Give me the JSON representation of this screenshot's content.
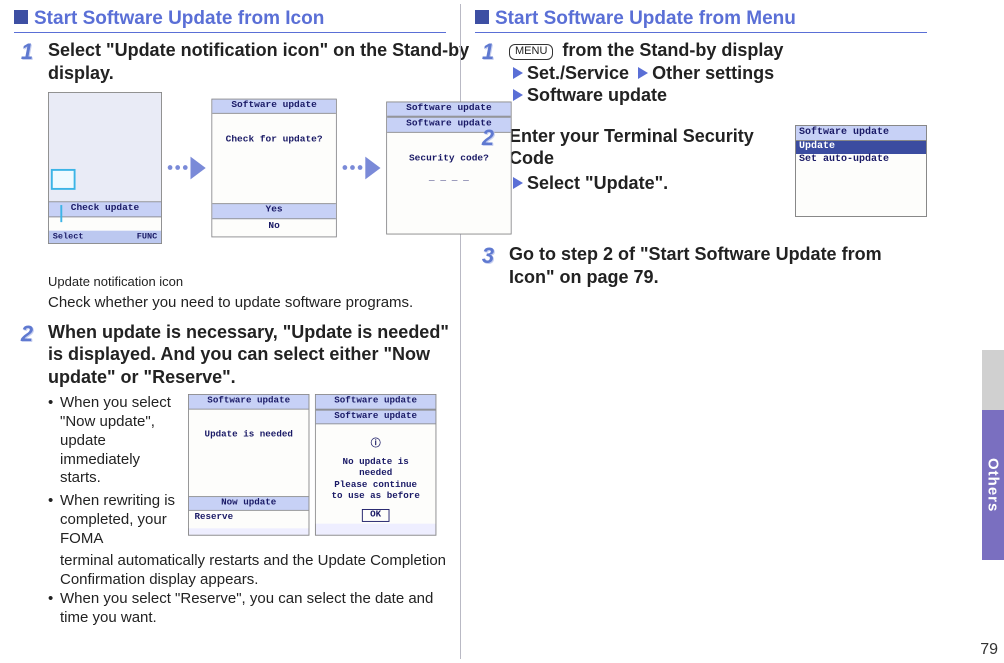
{
  "left": {
    "title": "Start Software Update from Icon",
    "step1": {
      "heading": "Select \"Update notification icon\" on the Stand-by display.",
      "icon_caption": "Update notification icon",
      "note": "Check whether you need to update software programs.",
      "phoneA": {
        "title": "",
        "band": "Check update",
        "foot_left": "Select",
        "foot_right": "FUNC"
      },
      "phoneB": {
        "title": "Software update",
        "mid": "Check for update?",
        "opt1": "Yes",
        "opt2": "No"
      },
      "phoneC": {
        "title": "Software update",
        "band": "Software update",
        "mid": "Security code?",
        "entry": "_ _ _ _"
      }
    },
    "step2": {
      "heading": "When update is necessary, \"Update is needed\" is displayed. And you can select either \"Now update\" or \"Reserve\".",
      "b1": "When you select \"Now update\", update immediately starts.",
      "b2": "When rewriting is completed, your FOMA terminal automatically restarts and the Update Completion Confirmation display appears.",
      "b3": "When you select \"Reserve\", you can select the date and time you want.",
      "phoneD": {
        "title": "Software update",
        "mid": "Update is needed",
        "opt_sel": "Now update",
        "opt2": "Reserve"
      },
      "phoneE": {
        "title": "Software update",
        "band": "Software update",
        "l1": "No update is",
        "l2": "needed",
        "l3": "Please continue",
        "l4": "to use as before",
        "ok": "OK"
      }
    }
  },
  "right": {
    "title": "Start Software Update from Menu",
    "step1": {
      "menu_label": "MENU",
      "l1": " from the Stand-by display",
      "nav1": "Set./Service",
      "nav2": "Other settings",
      "nav3": "Software update"
    },
    "step2": {
      "l1": "Enter your Terminal Security Code",
      "l2": "Select \"Update\".",
      "phone": {
        "title": "Software update",
        "sel": "Update",
        "line": "Set auto-update"
      }
    },
    "step3": {
      "text": "Go to step 2 of \"Start Software Update from Icon\" on page 79."
    }
  },
  "side_label": "Others",
  "page_number": "79"
}
